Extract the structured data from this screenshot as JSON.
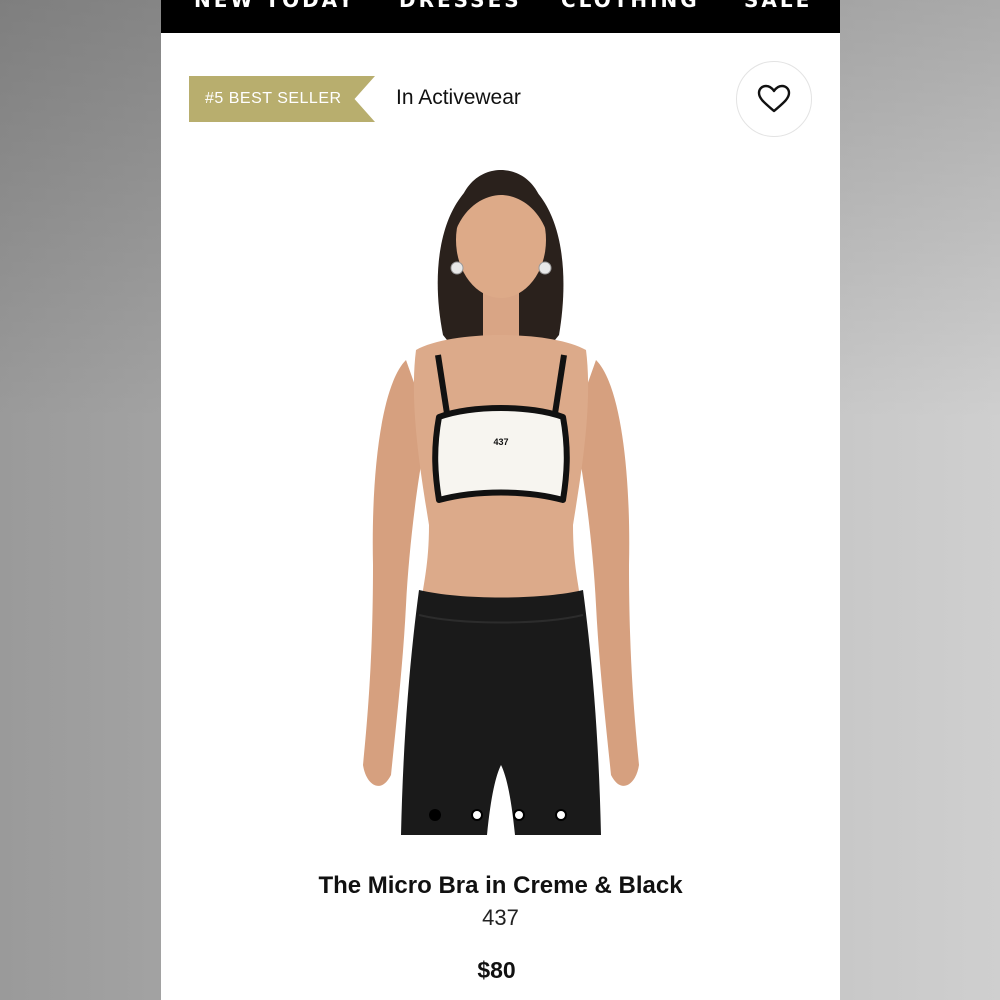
{
  "nav": {
    "items": [
      {
        "label": "NEW TODAY"
      },
      {
        "label": "DRESSES"
      },
      {
        "label": "CLOTHING"
      },
      {
        "label": "SALE"
      }
    ]
  },
  "badge": {
    "label": "#5 BEST SELLER",
    "category": "In Activewear",
    "color": "#b8ae6e"
  },
  "wishlist": {
    "icon": "heart-icon"
  },
  "product": {
    "image_logo_text": "437",
    "title": "The Micro Bra in Creme & Black",
    "brand": "437",
    "price": "$80"
  },
  "carousel": {
    "count": 4,
    "active_index": 0
  }
}
